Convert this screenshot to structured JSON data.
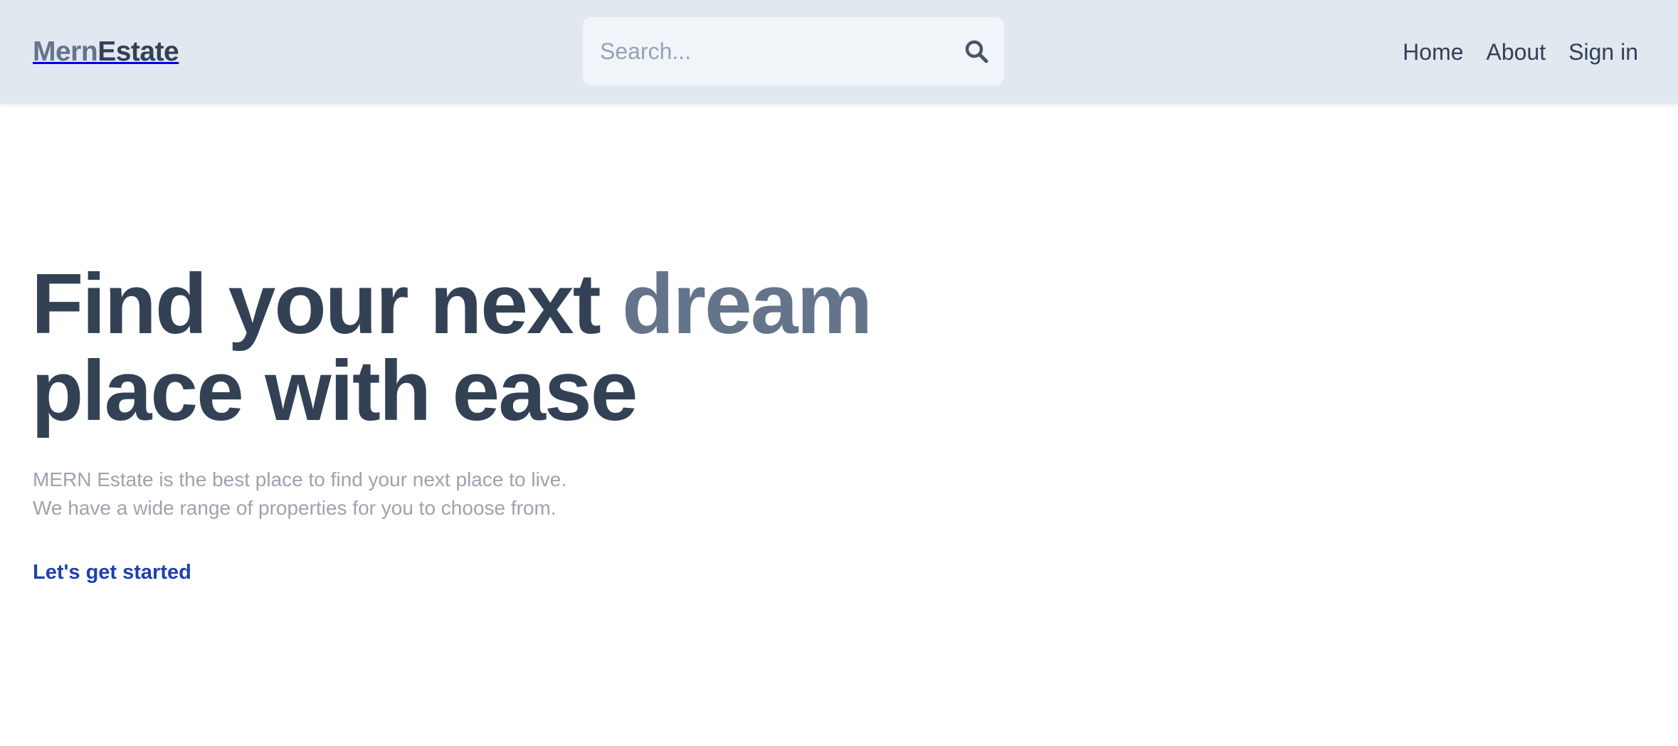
{
  "header": {
    "logo": {
      "part1": "Mern",
      "part2": "Estate"
    },
    "search": {
      "placeholder": "Search...",
      "value": "",
      "icon": "search-icon"
    },
    "nav": [
      {
        "label": "Home"
      },
      {
        "label": "About"
      },
      {
        "label": "Sign in"
      }
    ]
  },
  "hero": {
    "title": {
      "line1_start": "Find your next ",
      "line1_accent": "dream",
      "line2": "place with ease"
    },
    "description": {
      "line1": "MERN Estate is the best place to find your next place to live.",
      "line2": "We have a wide range of properties for you to choose from."
    },
    "cta_label": "Let's get started"
  },
  "colors": {
    "header_bg": "#e2e8f0",
    "search_bg": "#f1f5f9",
    "text_dark": "#334155",
    "text_muted": "#64748b",
    "text_light": "#9ca3af",
    "link": "#1e40af"
  }
}
